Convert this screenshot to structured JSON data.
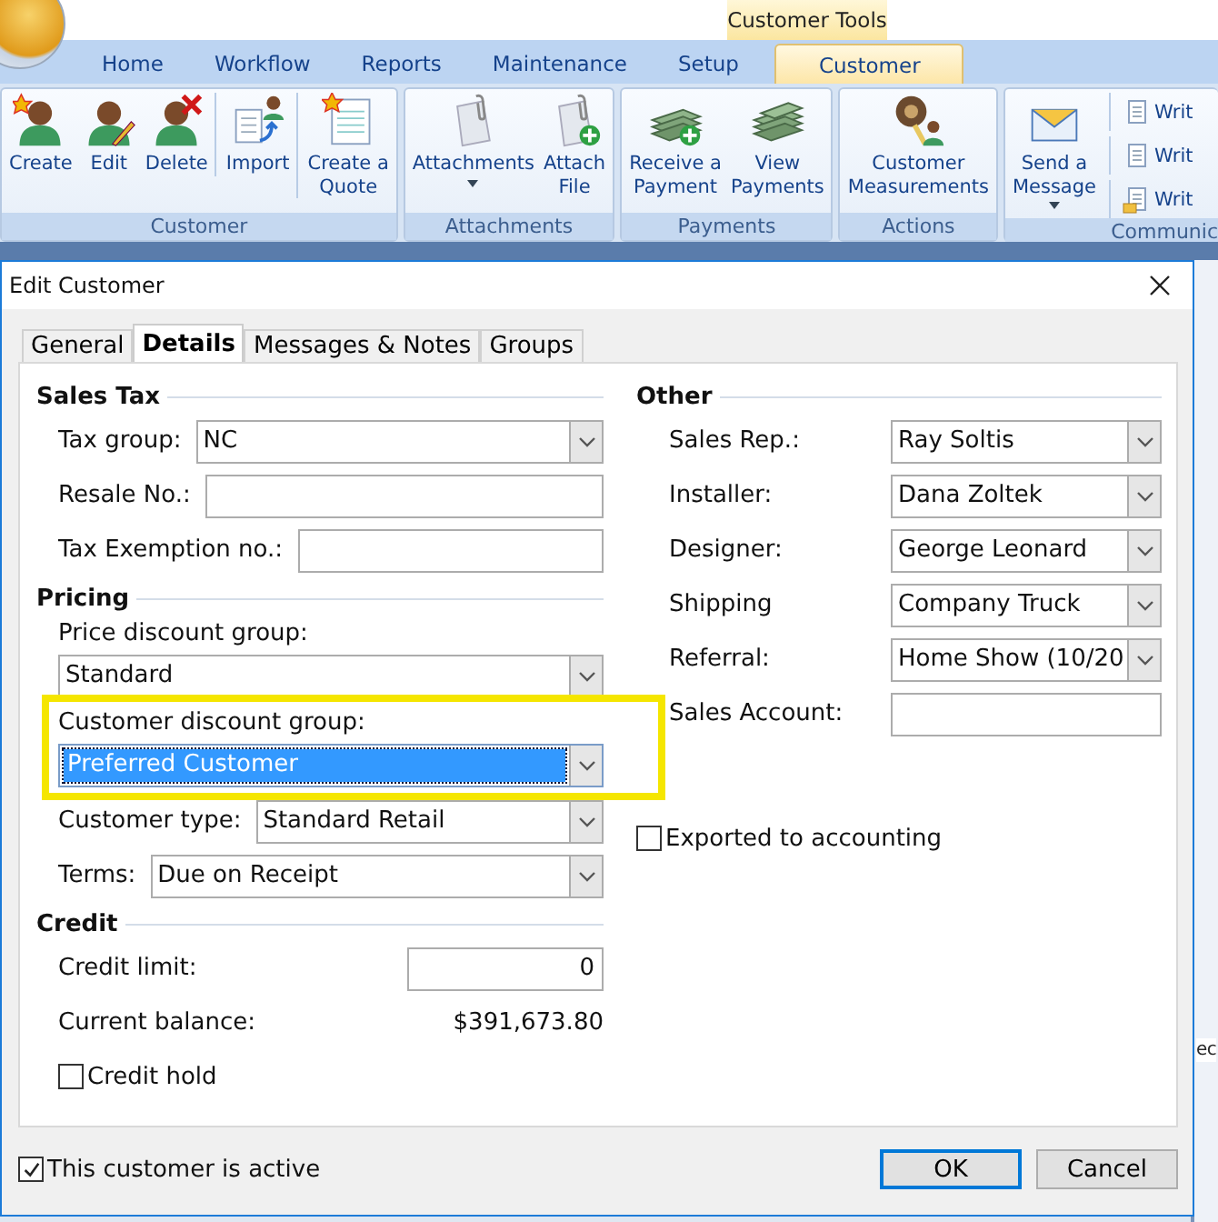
{
  "app": {
    "context_tab": "Customer Tools",
    "tabs": [
      {
        "label": "Home",
        "selected": false
      },
      {
        "label": "Workflow",
        "selected": false
      },
      {
        "label": "Reports",
        "selected": false
      },
      {
        "label": "Maintenance",
        "selected": false
      },
      {
        "label": "Setup",
        "selected": false
      },
      {
        "label": "Customer",
        "selected": true
      }
    ],
    "ribbon_groups": [
      {
        "label": "Customer",
        "buttons": [
          {
            "kind": "large",
            "lines": [
              "Create"
            ],
            "separated": false,
            "dropdown": false
          },
          {
            "kind": "large",
            "lines": [
              "Edit"
            ],
            "separated": false,
            "dropdown": false
          },
          {
            "kind": "large",
            "lines": [
              "Delete"
            ],
            "separated": false,
            "dropdown": false
          },
          {
            "kind": "large",
            "lines": [
              "Import"
            ],
            "separated": true,
            "dropdown": false
          },
          {
            "kind": "large",
            "lines": [
              "Create a",
              "Quote"
            ],
            "separated": true,
            "dropdown": false
          }
        ]
      },
      {
        "label": "Attachments",
        "buttons": [
          {
            "kind": "large",
            "lines": [
              "Attachments"
            ],
            "separated": false,
            "dropdown": true
          },
          {
            "kind": "large",
            "lines": [
              "Attach",
              "File"
            ],
            "separated": false,
            "dropdown": false
          }
        ]
      },
      {
        "label": "Payments",
        "buttons": [
          {
            "kind": "large",
            "lines": [
              "Receive a",
              "Payment"
            ],
            "separated": false,
            "dropdown": false
          },
          {
            "kind": "large",
            "lines": [
              "View",
              "Payments"
            ],
            "separated": false,
            "dropdown": false
          }
        ]
      },
      {
        "label": "Actions",
        "buttons": [
          {
            "kind": "large",
            "lines": [
              "Customer",
              "Measurements"
            ],
            "separated": false,
            "dropdown": false
          }
        ]
      },
      {
        "label": "Communic",
        "buttons": [
          {
            "kind": "large",
            "lines": [
              "Send a",
              "Message"
            ],
            "separated": false,
            "dropdown": true
          },
          {
            "kind": "small",
            "lines": [
              "Writ"
            ],
            "separated": true
          },
          {
            "kind": "small",
            "lines": [
              "Writ"
            ],
            "separated": true
          },
          {
            "kind": "small",
            "lines": [
              "Writ"
            ],
            "separated": true
          }
        ]
      }
    ],
    "background_tab": "ec"
  },
  "dialog": {
    "title": "Edit Customer",
    "tabs": [
      {
        "label": "General",
        "selected": false
      },
      {
        "label": "Details",
        "selected": true
      },
      {
        "label": "Messages & Notes",
        "selected": false
      },
      {
        "label": "Groups",
        "selected": false
      }
    ],
    "left_sections": [
      {
        "heading": "Sales Tax",
        "rows": [
          {
            "kind": "combo",
            "label": "Tax group:",
            "value": "NC"
          },
          {
            "kind": "field",
            "label": "Resale No.:"
          },
          {
            "kind": "field",
            "label": "Tax Exemption no.:"
          }
        ]
      },
      {
        "heading": "Pricing",
        "rows": [
          {
            "kind": "stacked_combo",
            "label": "Price discount group:",
            "value": "Standard",
            "focused": false,
            "highlighted": false
          },
          {
            "kind": "stacked_combo",
            "label": "Customer discount group:",
            "value": "Preferred Customer",
            "focused": true,
            "highlighted": true
          },
          {
            "kind": "combo",
            "label": "Customer type:",
            "value": "Standard Retail"
          },
          {
            "kind": "combo",
            "label": "Terms:",
            "value": "Due on Receipt"
          }
        ]
      },
      {
        "heading": "Credit",
        "rows": [
          {
            "kind": "field",
            "label": "Credit limit:",
            "value": "0",
            "numeric": true
          },
          {
            "kind": "readout",
            "label": "Current balance:",
            "value": "$391,673.80"
          },
          {
            "kind": "checkbox",
            "label": "Credit hold",
            "checked": false
          }
        ]
      }
    ],
    "right_sections": [
      {
        "heading": "Other",
        "rows": [
          {
            "kind": "combo",
            "label": "Sales Rep.:",
            "value": "Ray Soltis"
          },
          {
            "kind": "combo",
            "label": "Installer:",
            "value": "Dana Zoltek"
          },
          {
            "kind": "combo",
            "label": "Designer:",
            "value": "George Leonard"
          },
          {
            "kind": "combo",
            "label": "Shipping",
            "value": "Company Truck"
          },
          {
            "kind": "combo",
            "label": "Referral:",
            "value": "Home Show (10/20"
          },
          {
            "kind": "field",
            "label": "Sales Account:"
          },
          {
            "kind": "checkbox",
            "label": "Exported to accounting",
            "checked": false
          }
        ]
      }
    ],
    "active": {
      "label": "This customer is active",
      "checked": true
    },
    "buttons": [
      {
        "label": "OK",
        "default": true
      },
      {
        "label": "Cancel",
        "default": false
      }
    ]
  }
}
